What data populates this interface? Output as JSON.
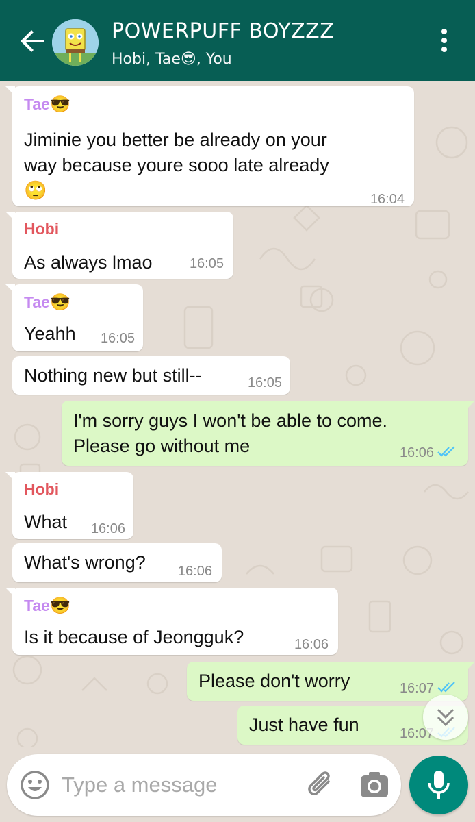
{
  "header": {
    "title": "POWERPUFF BOYZZZ",
    "subtitle": "Hobi, Tae😎, You",
    "background": "#075e54"
  },
  "messages": [
    {
      "direction": "in",
      "sender": "Tae",
      "sender_emoji": "😎",
      "sender_color": "#c58af0",
      "lines": [
        "Jiminie you better be already on your",
        "way because youre sooo late already",
        "🙄"
      ],
      "time": "16:04"
    },
    {
      "direction": "in",
      "sender": "Hobi",
      "sender_color": "#e2575e",
      "lines": [
        "As always lmao"
      ],
      "time": "16:05"
    },
    {
      "direction": "in",
      "sender": "Tae",
      "sender_emoji": "😎",
      "sender_color": "#c58af0",
      "lines": [
        "Yeahh"
      ],
      "time": "16:05"
    },
    {
      "direction": "in",
      "lines": [
        "Nothing new but still--"
      ],
      "time": "16:05"
    },
    {
      "direction": "out",
      "lines": [
        "I'm sorry guys I won't be able to come.",
        "Please go without me"
      ],
      "time": "16:06",
      "status": "read"
    },
    {
      "direction": "in",
      "sender": "Hobi",
      "sender_color": "#e2575e",
      "lines": [
        "What"
      ],
      "time": "16:06"
    },
    {
      "direction": "in",
      "lines": [
        "What's wrong?"
      ],
      "time": "16:06"
    },
    {
      "direction": "in",
      "sender": "Tae",
      "sender_emoji": "😎",
      "sender_color": "#c58af0",
      "lines": [
        "Is it because of Jeongguk?"
      ],
      "time": "16:06"
    },
    {
      "direction": "out",
      "lines": [
        "Please don't worry"
      ],
      "time": "16:07",
      "status": "read"
    },
    {
      "direction": "out",
      "lines": [
        "Just have fun"
      ],
      "time": "16:07",
      "status": "read"
    }
  ],
  "input": {
    "placeholder": "Type a message"
  },
  "icons": {
    "back": "arrow-left-icon",
    "menu": "more-vert-icon",
    "emoji": "smiley-icon",
    "attach": "paperclip-icon",
    "camera": "camera-icon",
    "mic": "mic-icon",
    "scroll_down": "double-chevron-down-icon"
  },
  "colors": {
    "chat_bg": "#e5ddd5",
    "incoming_bubble": "#ffffff",
    "outgoing_bubble": "#dcf8c6",
    "read_ticks": "#4fc3f7",
    "accent": "#00897b"
  }
}
